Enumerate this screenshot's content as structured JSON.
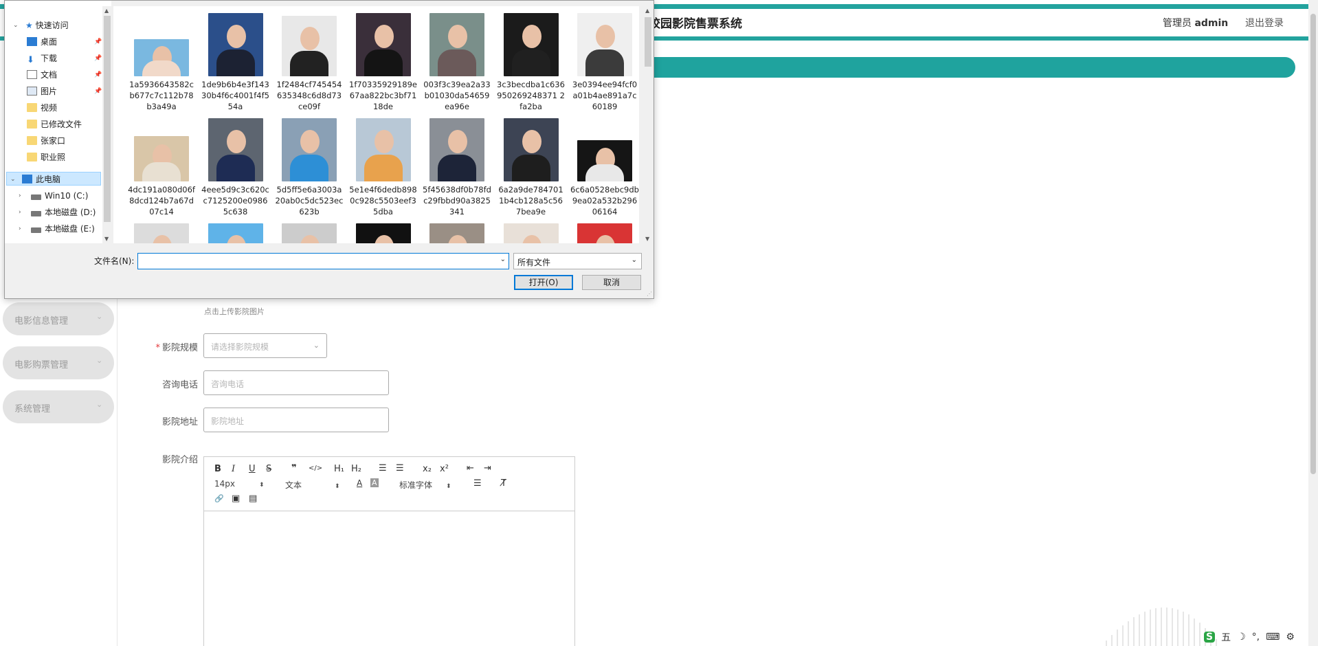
{
  "app": {
    "title": "校园影院售票系统",
    "admin_prefix": "管理员",
    "admin_name": "admin",
    "logout": "退出登录",
    "accent_color": "#23a39e"
  },
  "sidebar": {
    "items": [
      {
        "label": "电影信息管理"
      },
      {
        "label": "电影购票管理"
      },
      {
        "label": "系统管理"
      }
    ]
  },
  "form": {
    "upload_hint": "点击上传影院图片",
    "scale_label": "影院规模",
    "scale_placeholder": "请选择影院规模",
    "phone_label": "咨询电话",
    "phone_placeholder": "咨询电话",
    "address_label": "影院地址",
    "address_placeholder": "影院地址",
    "intro_label": "影院介绍"
  },
  "editor": {
    "bold": "B",
    "italic": "I",
    "underline": "U",
    "strike": "S",
    "quote": "❞",
    "code": "</>",
    "h1": "H₁",
    "h2": "H₂",
    "ol": "☰",
    "ul": "☰",
    "sub": "x₂",
    "sup": "x²",
    "outdent": "⇤",
    "indent": "⇥",
    "size": "14px",
    "header": "文本",
    "color": "A",
    "background": "A",
    "font": "标准字体",
    "align": "☰",
    "clean": "T̸",
    "link": "🔗",
    "image": "▣",
    "video": "▤"
  },
  "dialog": {
    "tree": [
      {
        "label": "快速访问",
        "icon": "star-icon"
      },
      {
        "label": "桌面",
        "icon": "desktop-icon",
        "pinned": true
      },
      {
        "label": "下载",
        "icon": "download-icon",
        "pinned": true
      },
      {
        "label": "文档",
        "icon": "document-icon",
        "pinned": true
      },
      {
        "label": "图片",
        "icon": "pictures-icon",
        "pinned": true
      },
      {
        "label": "视频",
        "icon": "folder-icon"
      },
      {
        "label": "已修改文件",
        "icon": "folder-icon"
      },
      {
        "label": "张家口",
        "icon": "folder-icon"
      },
      {
        "label": "职业照",
        "icon": "folder-icon"
      },
      {
        "label": "此电脑",
        "icon": "computer-icon",
        "selected": true
      },
      {
        "label": "Win10 (C:)",
        "icon": "drive-icon"
      },
      {
        "label": "本地磁盘 (D:)",
        "icon": "drive-icon"
      },
      {
        "label": "本地磁盘 (E:)",
        "icon": "drive-icon"
      }
    ],
    "files": [
      {
        "name": "1a5936643582cb677c7c112b78b3a49a"
      },
      {
        "name": "1de9b6b4e3f14330b4f6c4001f4f554a"
      },
      {
        "name": "1f2484cf745454635348c6d8d73ce09f"
      },
      {
        "name": "1f70335929189e67aa822bc3bf7118de"
      },
      {
        "name": "003f3c39ea2a33b01030da54659ea96e"
      },
      {
        "name": "3c3becdba1c636950269248371 2fa2ba"
      },
      {
        "name": "3e0394ee94fcf0a01b4ae891a7c60189"
      },
      {
        "name": "4dc191a080d06f8dcd124b7a67d07c14"
      },
      {
        "name": "4eee5d9c3c620cc7125200e09865c638"
      },
      {
        "name": "5d5ff5e6a3003a20ab0c5dc523ec623b"
      },
      {
        "name": "5e1e4f6dedb8980c928c5503eef35dba"
      },
      {
        "name": "5f45638df0b78fdc29fbbd90a3825341"
      },
      {
        "name": "6a2a9de7847011b4cb128a5c567bea9e"
      },
      {
        "name": "6c6a0528ebc9db9ea02a532b29606164"
      },
      {
        "name": ""
      },
      {
        "name": ""
      },
      {
        "name": ""
      },
      {
        "name": ""
      },
      {
        "name": ""
      },
      {
        "name": ""
      },
      {
        "name": ""
      }
    ],
    "filename_label": "文件名(N):",
    "filename_value": "",
    "filetype": "所有文件",
    "open": "打开(O)",
    "cancel": "取消"
  }
}
